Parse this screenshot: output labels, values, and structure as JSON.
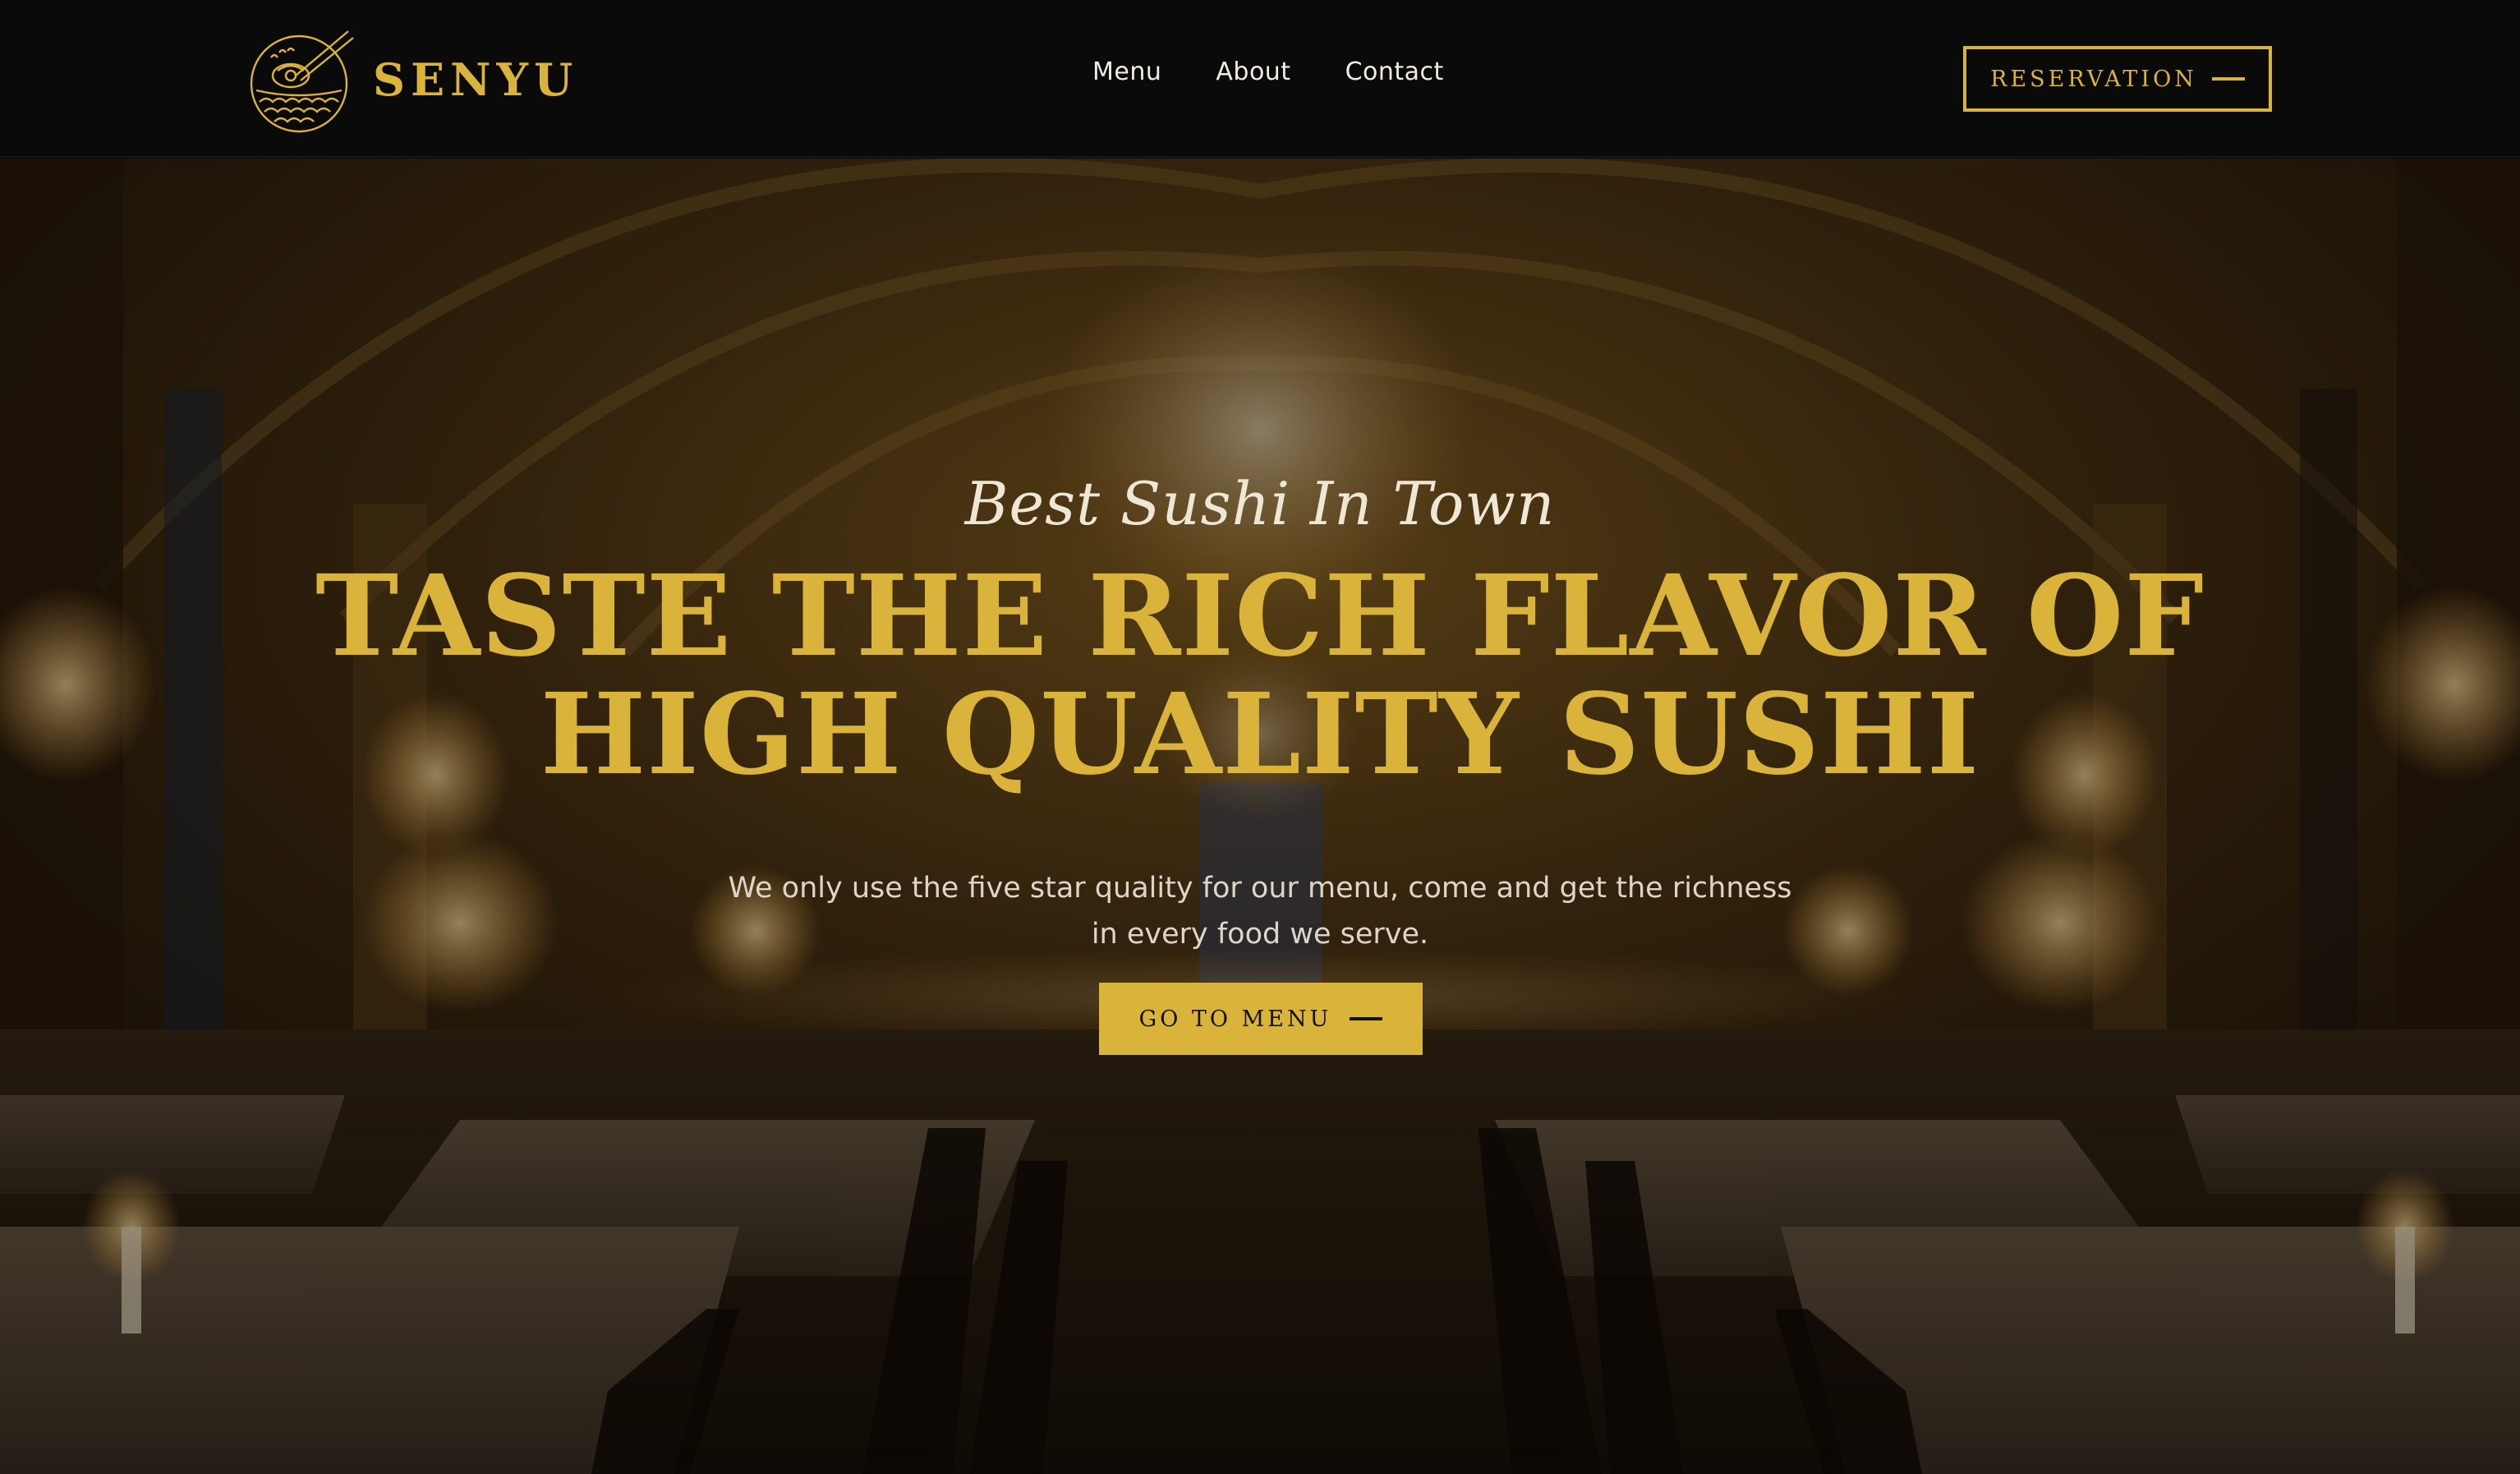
{
  "brand": {
    "name": "SENYU",
    "logo_icon": "sushi-bowl-chopsticks-icon",
    "color": "#d9b33a"
  },
  "nav": {
    "items": [
      {
        "label": "Menu"
      },
      {
        "label": "About"
      },
      {
        "label": "Contact"
      }
    ]
  },
  "header": {
    "reservation_label": "RESERVATION"
  },
  "hero": {
    "background": "dimly lit restaurant dining hall with chandelier",
    "tagline": "Best Sushi In Town",
    "headline_line1": "TASTE THE RICH FLAVOR OF",
    "headline_line2": "HIGH QUALITY SUSHI",
    "subtext": "We only use the five star quality for our menu, come and get the richness in every food we serve.",
    "cta_label": "GO TO MENU"
  },
  "colors": {
    "accent": "#d9b33a",
    "header_bg": "#0a0a0a",
    "text_light": "#f1ede4"
  }
}
